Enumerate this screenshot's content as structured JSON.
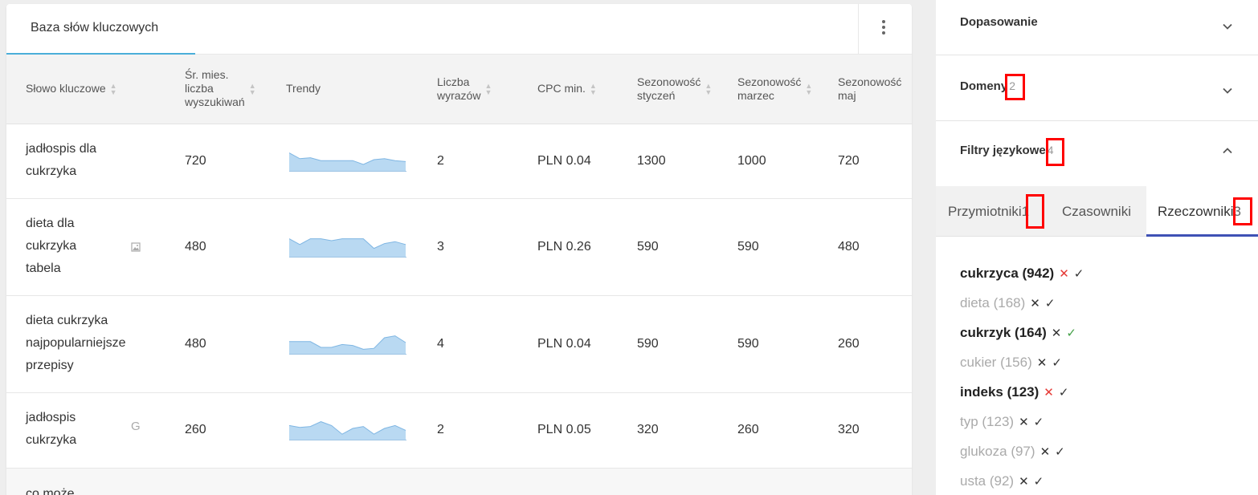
{
  "table_card": {
    "tab_label": "Baza słów kluczowych",
    "columns": [
      {
        "label": [
          "Słowo kluczowe"
        ]
      },
      {
        "label": [
          "Śr. mies.",
          "liczba",
          "wyszukiwań"
        ]
      },
      {
        "label": [
          "Trendy"
        ]
      },
      {
        "label": [
          "Liczba",
          "wyrazów"
        ]
      },
      {
        "label": [
          "CPC min."
        ]
      },
      {
        "label": [
          "Sezonowość",
          "styczeń"
        ]
      },
      {
        "label": [
          "Sezonowość",
          "marzec"
        ]
      },
      {
        "label": [
          "Sezonowość",
          "maj"
        ]
      }
    ],
    "rows": [
      {
        "keyword": [
          "jadłospis dla",
          "cukrzyka"
        ],
        "icon": "",
        "volume": "720",
        "words": "2",
        "cpc": "PLN 0.04",
        "jan": "1300",
        "mar": "1000",
        "may": "720",
        "trend": [
          0.85,
          0.55,
          0.6,
          0.45,
          0.45,
          0.45,
          0.45,
          0.25,
          0.5,
          0.55,
          0.45,
          0.4
        ]
      },
      {
        "keyword": [
          "dieta dla",
          "cukrzyka",
          "tabela"
        ],
        "icon": "image-icon",
        "volume": "480",
        "words": "3",
        "cpc": "PLN 0.26",
        "jan": "590",
        "mar": "590",
        "may": "480",
        "trend": [
          0.85,
          0.55,
          0.85,
          0.85,
          0.75,
          0.85,
          0.85,
          0.85,
          0.35,
          0.6,
          0.7,
          0.55
        ]
      },
      {
        "keyword": [
          "dieta cukrzyka",
          "najpopularniejsze",
          "przepisy"
        ],
        "icon": "",
        "volume": "480",
        "words": "4",
        "cpc": "PLN 0.04",
        "jan": "590",
        "mar": "590",
        "may": "260",
        "trend": [
          0.55,
          0.55,
          0.55,
          0.25,
          0.25,
          0.4,
          0.35,
          0.15,
          0.2,
          0.75,
          0.85,
          0.5
        ]
      },
      {
        "keyword": [
          "jadłospis",
          "cukrzyka"
        ],
        "icon": "google-icon",
        "volume": "260",
        "words": "2",
        "cpc": "PLN 0.05",
        "jan": "320",
        "mar": "260",
        "may": "320",
        "trend": [
          0.65,
          0.55,
          0.6,
          0.85,
          0.65,
          0.2,
          0.5,
          0.6,
          0.2,
          0.5,
          0.65,
          0.4
        ]
      }
    ],
    "partial_row_keyword": "co może"
  },
  "filters": {
    "sections": [
      {
        "title": "Dopasowanie",
        "count": ""
      },
      {
        "title": "Domeny",
        "count": "2"
      },
      {
        "title": "Filtry językowe",
        "count": "4"
      }
    ],
    "lang_tabs": [
      {
        "label": "Przymiotniki",
        "count": "1"
      },
      {
        "label": "Czasowniki",
        "count": ""
      },
      {
        "label": "Rzeczowniki",
        "count": "3"
      }
    ],
    "words": [
      {
        "text": "cukrzyca (942)",
        "bold": true,
        "state": "excluded"
      },
      {
        "text": "dieta (168)",
        "bold": false,
        "state": "none"
      },
      {
        "text": "cukrzyk (164)",
        "bold": true,
        "state": "included"
      },
      {
        "text": "cukier (156)",
        "bold": false,
        "state": "none"
      },
      {
        "text": "indeks (123)",
        "bold": true,
        "state": "excluded"
      },
      {
        "text": "typ (123)",
        "bold": false,
        "state": "none"
      },
      {
        "text": "glukoza (97)",
        "bold": false,
        "state": "none"
      },
      {
        "text": "usta (92)",
        "bold": false,
        "state": "none"
      }
    ],
    "cross_symbol": "✕",
    "check_symbol": "✓",
    "accent_color": "#3f51b5",
    "highlight_color": "#ff0000"
  }
}
